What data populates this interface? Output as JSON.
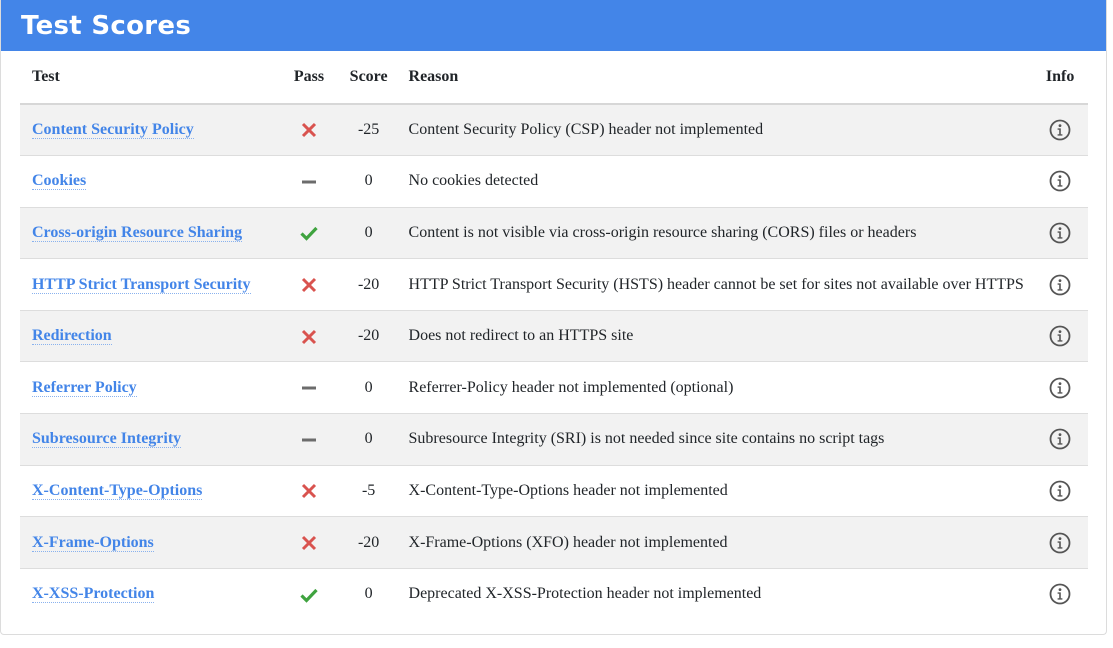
{
  "title": "Test Scores",
  "columns": {
    "test": "Test",
    "pass": "Pass",
    "score": "Score",
    "reason": "Reason",
    "info": "Info"
  },
  "colors": {
    "header_bg": "#4385e8",
    "link": "#4385e8",
    "fail": "#d9534f",
    "pass": "#3fa33f",
    "neutral": "#6c6c6c"
  },
  "rows": [
    {
      "test": "Content Security Policy",
      "pass": "fail",
      "score": "-25",
      "reason": "Content Security Policy (CSP) header not implemented"
    },
    {
      "test": "Cookies",
      "pass": "neutral",
      "score": "0",
      "reason": "No cookies detected"
    },
    {
      "test": "Cross-origin Resource Sharing",
      "pass": "pass",
      "score": "0",
      "reason": "Content is not visible via cross-origin resource sharing (CORS) files or headers"
    },
    {
      "test": "HTTP Strict Transport Security",
      "pass": "fail",
      "score": "-20",
      "reason": "HTTP Strict Transport Security (HSTS) header cannot be set for sites not available over HTTPS"
    },
    {
      "test": "Redirection",
      "pass": "fail",
      "score": "-20",
      "reason": "Does not redirect to an HTTPS site"
    },
    {
      "test": "Referrer Policy",
      "pass": "neutral",
      "score": "0",
      "reason": "Referrer-Policy header not implemented (optional)"
    },
    {
      "test": "Subresource Integrity",
      "pass": "neutral",
      "score": "0",
      "reason": "Subresource Integrity (SRI) is not needed since site contains no script tags"
    },
    {
      "test": "X-Content-Type-Options",
      "pass": "fail",
      "score": "-5",
      "reason": "X-Content-Type-Options header not implemented"
    },
    {
      "test": "X-Frame-Options",
      "pass": "fail",
      "score": "-20",
      "reason": "X-Frame-Options (XFO) header not implemented"
    },
    {
      "test": "X-XSS-Protection",
      "pass": "pass",
      "score": "0",
      "reason": "Deprecated X-XSS-Protection header not implemented"
    }
  ]
}
